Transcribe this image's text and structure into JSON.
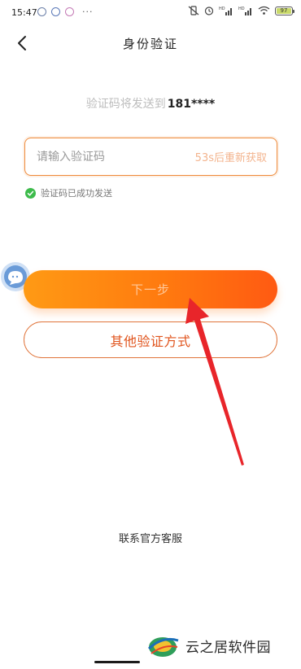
{
  "status_bar": {
    "time": "15:47",
    "more": "···",
    "battery_level": "97",
    "network_labels": [
      "HD",
      "HD"
    ]
  },
  "nav": {
    "title": "身份验证",
    "back_icon": "chevron-left-icon"
  },
  "verification": {
    "send_prefix": "验证码将发送到",
    "phone_masked": "181****",
    "code_placeholder": "请输入验证码",
    "code_value": "",
    "resend_countdown": "53s后重新获取",
    "sent_hint": "验证码已成功发送"
  },
  "actions": {
    "next_label": "下一步",
    "other_methods_label": "其他验证方式"
  },
  "footer": {
    "customer_service": "联系官方客服"
  },
  "watermark": {
    "text": "云之居软件园"
  },
  "colors": {
    "accent": "#ff7a0f",
    "accent_border": "#e0753b",
    "success": "#3dbb4b",
    "annotation_arrow": "#e8252a"
  }
}
